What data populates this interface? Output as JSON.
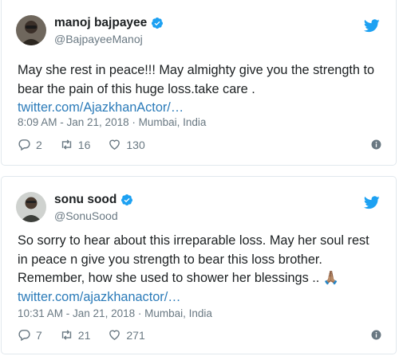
{
  "tweets": [
    {
      "name": "manoj bajpayee",
      "handle": "@BajpayeeManoj",
      "text": "May she rest in peace!!! May almighty give you the strength to bear the pain of this huge loss.take care .",
      "link": "twitter.com/AjazkhanActor/…",
      "timestamp": "8:09 AM - Jan 21, 2018 · Mumbai, India",
      "replies": "2",
      "retweets": "16",
      "likes": "130"
    },
    {
      "name": "sonu sood",
      "handle": "@SonuSood",
      "text": "So sorry to hear about this irreparable loss. May her soul rest in peace n give you strength to bear this loss brother. Remember, how she used to shower her blessings .. 🙏🏽",
      "link": "twitter.com/ajazkhanactor/…",
      "timestamp": "10:31 AM - Jan 21, 2018 · Mumbai, India",
      "replies": "7",
      "retweets": "21",
      "likes": "271"
    }
  ],
  "colors": {
    "brand": "#1da1f2",
    "link": "#2b7bb9",
    "muted": "#697882",
    "text": "#1c2022",
    "border": "#e1e8ed"
  },
  "icons": {
    "verified": "verified-badge-icon",
    "logo": "twitter-bird-icon",
    "reply": "reply-icon",
    "retweet": "retweet-icon",
    "like": "heart-icon",
    "info": "info-icon"
  }
}
